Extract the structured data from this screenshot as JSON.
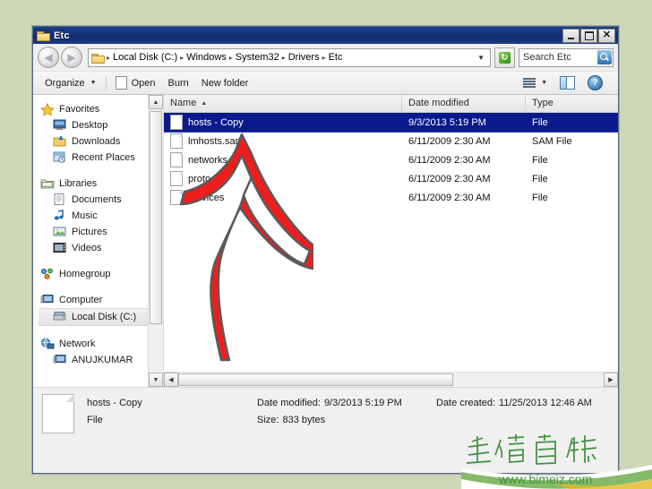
{
  "window": {
    "title": "Etc",
    "title_icon": "folder-icon",
    "buttons": {
      "minimize": "_",
      "maximize": "□",
      "close": "✕"
    }
  },
  "address_bar": {
    "back_icon": "back-arrow-icon",
    "forward_icon": "forward-arrow-icon",
    "folder_icon": "folder-icon",
    "crumbs": [
      "Local Disk (C:)",
      "Windows",
      "System32",
      "Drivers",
      "Etc"
    ],
    "separator": "▸",
    "dropdown_icon": "chevron-down-icon",
    "refresh_icon": "refresh-icon",
    "refresh_glyph": "↻",
    "search": {
      "value": "Search Etc",
      "placeholder": "Search Etc",
      "icon": "search-icon"
    }
  },
  "toolbar": {
    "organize": "Organize",
    "organize_caret": "▼",
    "open": "Open",
    "burn": "Burn",
    "new_folder": "New folder",
    "view_caret": "▼",
    "help_glyph": "?",
    "icons": {
      "open": "document-icon",
      "views": "view-list-icon",
      "preview_pane": "preview-pane-icon",
      "help": "help-icon"
    }
  },
  "nav_pane": {
    "groups": [
      {
        "header": {
          "label": "Favorites",
          "icon": "star-icon"
        },
        "items": [
          {
            "label": "Desktop",
            "icon": "desktop-icon"
          },
          {
            "label": "Downloads",
            "icon": "downloads-icon"
          },
          {
            "label": "Recent Places",
            "icon": "recent-places-icon"
          }
        ]
      },
      {
        "header": {
          "label": "Libraries",
          "icon": "libraries-icon"
        },
        "items": [
          {
            "label": "Documents",
            "icon": "documents-icon"
          },
          {
            "label": "Music",
            "icon": "music-icon"
          },
          {
            "label": "Pictures",
            "icon": "pictures-icon"
          },
          {
            "label": "Videos",
            "icon": "videos-icon"
          }
        ]
      },
      {
        "header": {
          "label": "Homegroup",
          "icon": "homegroup-icon"
        },
        "items": []
      },
      {
        "header": {
          "label": "Computer",
          "icon": "computer-icon"
        },
        "items": [
          {
            "label": "Local Disk (C:)",
            "icon": "harddisk-icon",
            "selected": true
          }
        ]
      },
      {
        "header": {
          "label": "Network",
          "icon": "network-icon"
        },
        "items": [
          {
            "label": "ANUJKUMAR",
            "icon": "computer-icon"
          }
        ]
      }
    ],
    "scroll": {
      "up_arrow": "▲",
      "down_arrow": "▼"
    }
  },
  "file_list": {
    "columns": [
      {
        "key": "name",
        "label": "Name",
        "sorted": true,
        "sort_mark": "▲"
      },
      {
        "key": "date",
        "label": "Date modified"
      },
      {
        "key": "type",
        "label": "Type"
      }
    ],
    "rows": [
      {
        "name": "hosts - Copy",
        "date": "9/3/2013 5:19 PM",
        "type": "File",
        "selected": true
      },
      {
        "name": "lmhosts.sam",
        "date": "6/11/2009 2:30 AM",
        "type": "SAM File",
        "selected": false
      },
      {
        "name": "networks",
        "date": "6/11/2009 2:30 AM",
        "type": "File",
        "selected": false
      },
      {
        "name": "protocol",
        "date": "6/11/2009 2:30 AM",
        "type": "File",
        "selected": false
      },
      {
        "name": "services",
        "date": "6/11/2009 2:30 AM",
        "type": "File",
        "selected": false
      }
    ],
    "scroll": {
      "left_arrow": "◀",
      "right_arrow": "▶"
    }
  },
  "details_pane": {
    "file_icon": "file-icon",
    "name": "hosts - Copy",
    "date_modified_label": "Date modified:",
    "date_modified_value": "9/3/2013 5:19 PM",
    "date_created_label": "Date created:",
    "date_created_value": "11/25/2013 12:46 AM",
    "type": "File",
    "size_label": "Size:",
    "size_value": "833 bytes"
  },
  "annotation": {
    "arrow_icon": "red-arrow-annotation",
    "color": "#ef1d1d"
  },
  "watermark": {
    "cjk_text": "生活百科",
    "url": "www.bimeiz.com",
    "color": "#3f8f3f"
  },
  "colors": {
    "desktop_background": "#cdd7b8",
    "titlebar": "#13317a",
    "selection": "#0a1a8c",
    "chrome": "#f0f0f0"
  }
}
